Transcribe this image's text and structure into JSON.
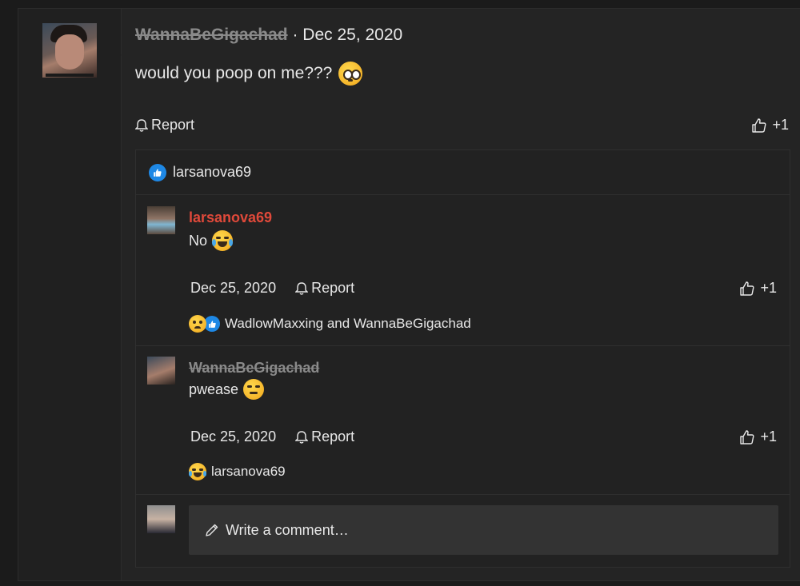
{
  "post": {
    "author": "WannaBeGigachad",
    "separator": "·",
    "date": "Dec 25, 2020",
    "text": "would you poop on me???",
    "report_label": "Report",
    "like_count": "+1"
  },
  "reactions_bar": {
    "user": "larsanova69"
  },
  "replies": [
    {
      "author": "larsanova69",
      "author_color": "#e0493a",
      "text": "No",
      "date": "Dec 25, 2020",
      "report_label": "Report",
      "like_count": "+1",
      "reacted_by": "WadlowMaxxing and WannaBeGigachad"
    },
    {
      "author": "WannaBeGigachad",
      "text": "pwease",
      "date": "Dec 25, 2020",
      "report_label": "Report",
      "like_count": "+1",
      "reacted_by": "larsanova69"
    }
  ],
  "composer": {
    "placeholder": "Write a comment…"
  },
  "icons": {
    "report": "bell-icon",
    "like": "thumbs-up-icon",
    "compose": "pencil-icon"
  },
  "colors": {
    "like_badge": "#1e88e5",
    "red_name": "#e0493a"
  }
}
